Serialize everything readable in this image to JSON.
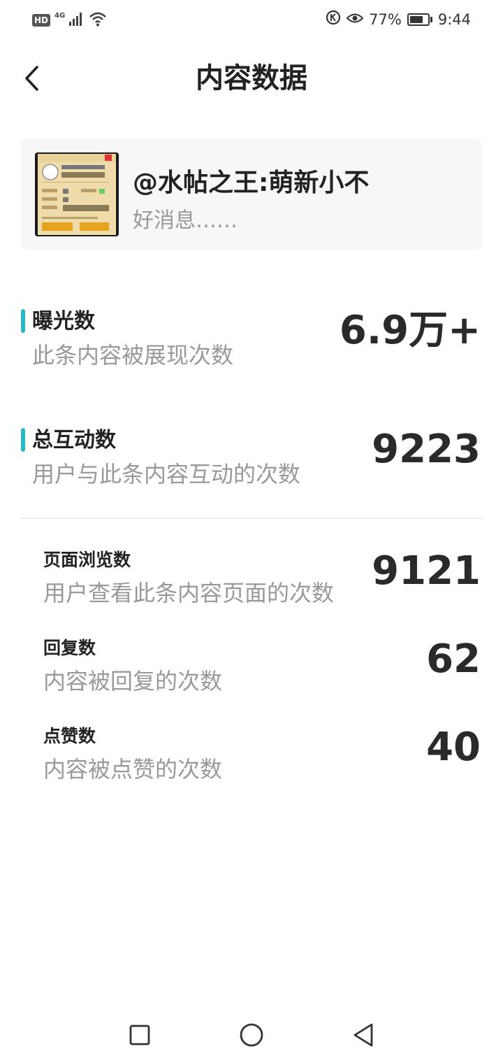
{
  "status_bar": {
    "hd": "HD",
    "network": "4G",
    "battery_text": "77%",
    "battery_level": 0.77,
    "time": "9:44"
  },
  "header": {
    "title": "内容数据"
  },
  "post": {
    "title": "@水帖之王:萌新小不",
    "excerpt": "好消息……"
  },
  "stats": {
    "exposure": {
      "label": "曝光数",
      "desc": "此条内容被展现次数",
      "value": "6.9万+"
    },
    "interaction": {
      "label": "总互动数",
      "desc": "用户与此条内容互动的次数",
      "value": "9223"
    },
    "page_views": {
      "label": "页面浏览数",
      "desc": "用户查看此条内容页面的次数",
      "value": "9121"
    },
    "replies": {
      "label": "回复数",
      "desc": "内容被回复的次数",
      "value": "62"
    },
    "likes": {
      "label": "点赞数",
      "desc": "内容被点赞的次数",
      "value": "40"
    }
  },
  "colors": {
    "accent": "#2bb7c3",
    "text_primary": "#222222",
    "text_secondary": "#999999",
    "card_bg": "#f7f7f7"
  },
  "icons": {
    "back": "chevron-left-icon",
    "recents": "square-icon",
    "home": "circle-icon",
    "nav_back": "triangle-back-icon"
  }
}
